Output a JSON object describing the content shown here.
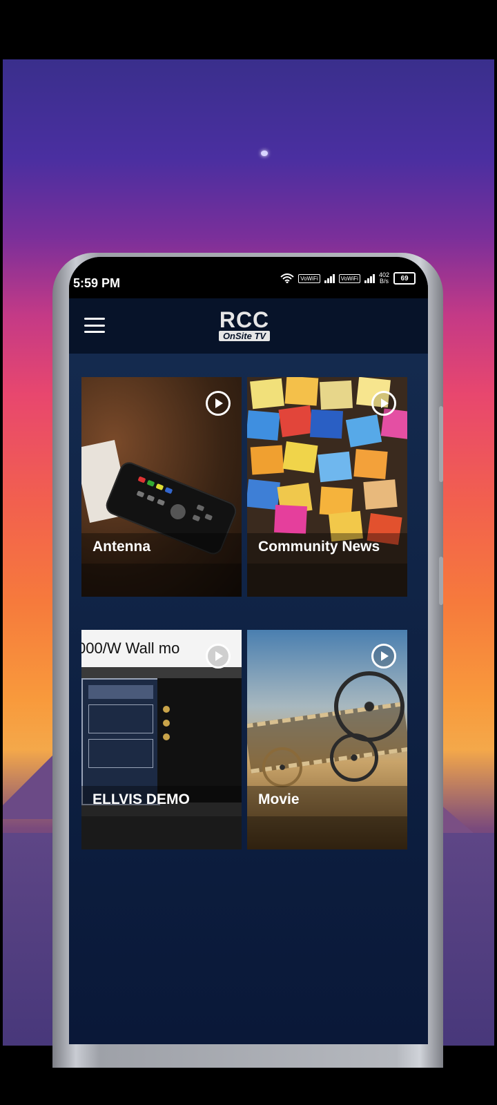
{
  "status_bar": {
    "time": "5:59 PM",
    "network_1": "VoWiFi",
    "network_2": "VoWiFi",
    "speed_value": "402",
    "speed_unit": "B/s",
    "battery": "69"
  },
  "app_bar": {
    "menu_icon": "hamburger-menu-icon",
    "logo_top": "RCC",
    "logo_bottom": "OnSite TV"
  },
  "channels": [
    {
      "label": "Antenna",
      "icon": "play-icon"
    },
    {
      "label": "Community News",
      "icon": "play-icon"
    },
    {
      "label": "ELLVIS DEMO",
      "icon": "play-icon",
      "thumbnail_text": "000/W Wall mo"
    },
    {
      "label": "Movie",
      "icon": "play-icon"
    }
  ],
  "colors": {
    "app_background": "#0d1f40",
    "app_bar": "#071329",
    "label_text": "#ffffff"
  }
}
